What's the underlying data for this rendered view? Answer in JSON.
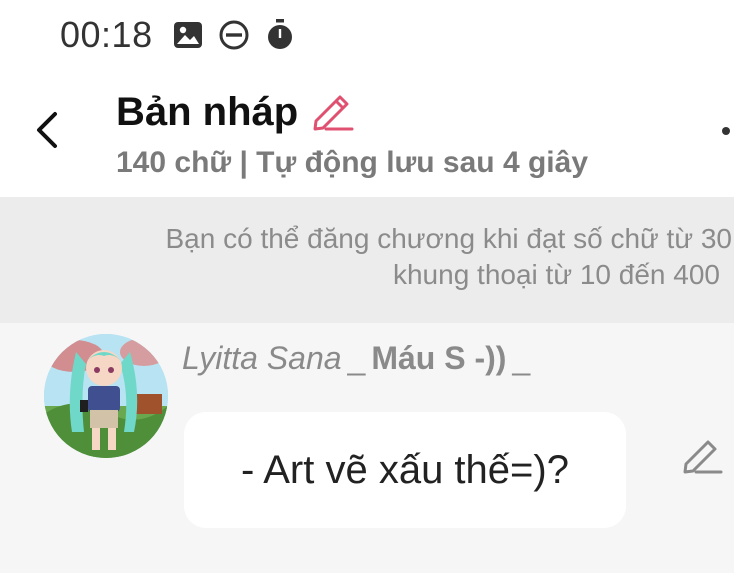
{
  "status_bar": {
    "time": "00:18",
    "icons": [
      "image-icon",
      "do-not-disturb-icon",
      "timer-icon"
    ]
  },
  "header": {
    "title": "Bản nháp",
    "subtitle": "140 chữ | Tự động lưu sau 4 giây",
    "accent_color": "#e05070"
  },
  "notice": {
    "line1": "Bạn có thể đăng chương khi đạt số chữ từ 30",
    "line2": "khung thoại từ 10 đến 400"
  },
  "message": {
    "character_name": "Lyitta Sana",
    "separator1": "_",
    "character_note": "Máu S -))",
    "separator2": "_",
    "text": "- Art vẽ xấu thế=)?"
  }
}
